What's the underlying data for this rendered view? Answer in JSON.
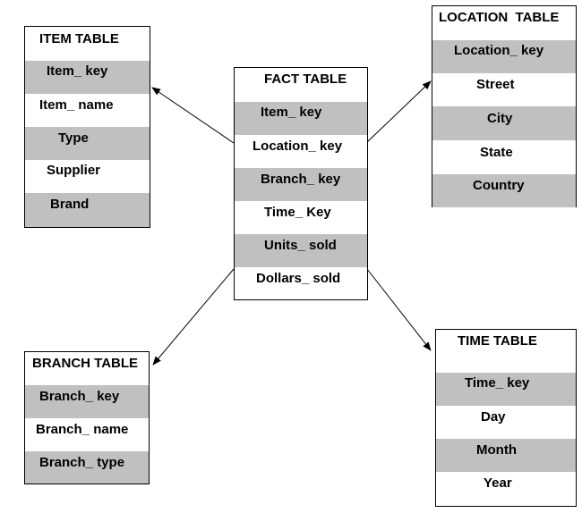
{
  "colors": {
    "shade": "#c0c0c0",
    "line": "#000000",
    "background": "#ffffff"
  },
  "tables": {
    "item": {
      "title": "ITEM TABLE",
      "rows": [
        "Item_ key",
        "Item_ name",
        "Type",
        "Supplier",
        "Brand"
      ]
    },
    "fact": {
      "title": "FACT TABLE",
      "rows": [
        "Item_ key",
        "Location_ key",
        "Branch_ key",
        "Time_ Key",
        "Units_ sold",
        "Dollars_ sold"
      ]
    },
    "location": {
      "title": "LOCATION  TABLE",
      "rows": [
        "Location_ key",
        "Street",
        "City",
        "State",
        "Country"
      ]
    },
    "branch": {
      "title": "BRANCH TABLE",
      "rows": [
        "Branch_ key",
        "Branch_ name",
        "Branch_ type"
      ]
    },
    "time": {
      "title": "TIME TABLE",
      "rows": [
        "Time_ key",
        "Day",
        "Month",
        "Year"
      ]
    }
  },
  "links": [
    {
      "from": "fact",
      "to": "item"
    },
    {
      "from": "fact",
      "to": "location"
    },
    {
      "from": "fact",
      "to": "branch"
    },
    {
      "from": "fact",
      "to": "time"
    }
  ]
}
